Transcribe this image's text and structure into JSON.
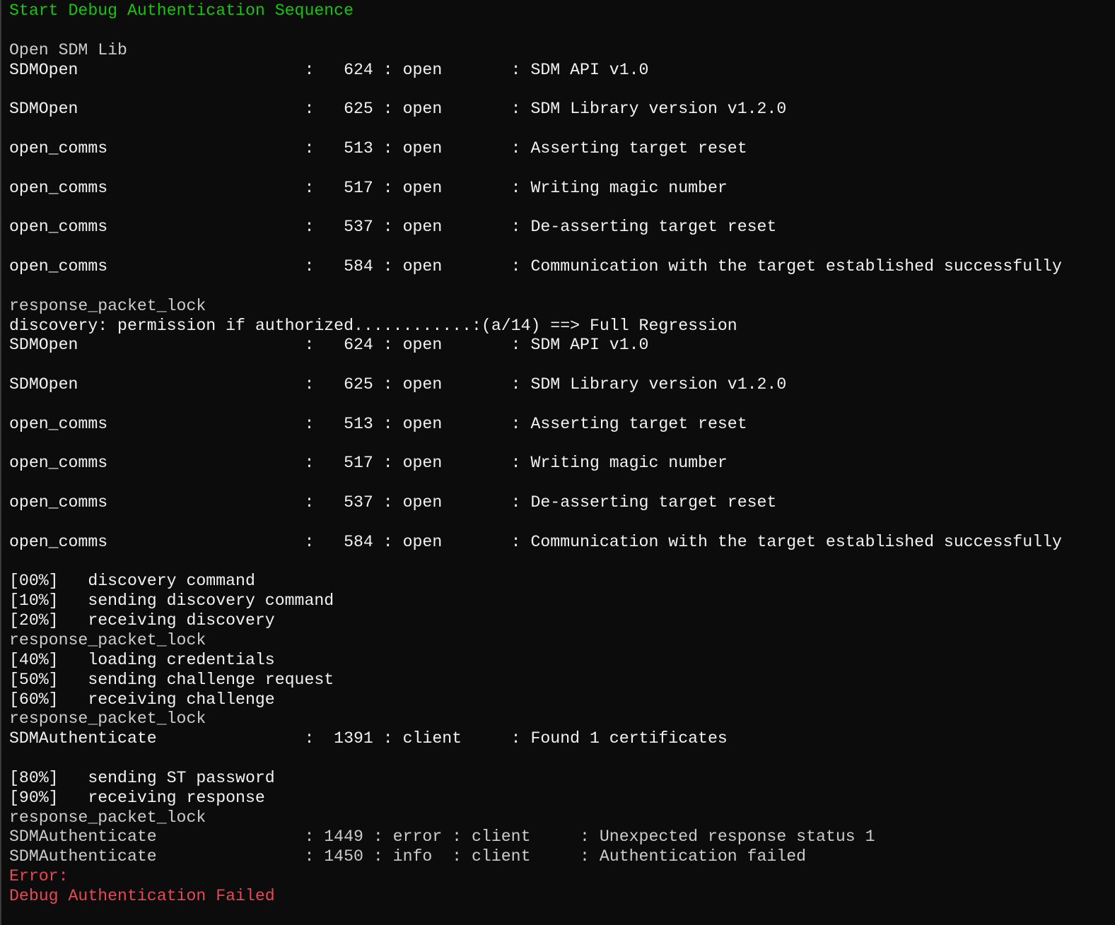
{
  "terminal": {
    "lines": [
      {
        "text": "Start Debug Authentication Sequence",
        "color": "green"
      },
      {
        "text": "",
        "color": "grey"
      },
      {
        "text": "Open SDM Lib",
        "color": "grey"
      },
      {
        "text": "SDMOpen                       :   624 : open       : SDM API v1.0",
        "color": "white"
      },
      {
        "text": "",
        "color": "grey"
      },
      {
        "text": "SDMOpen                       :   625 : open       : SDM Library version v1.2.0",
        "color": "white"
      },
      {
        "text": "",
        "color": "grey"
      },
      {
        "text": "open_comms                    :   513 : open       : Asserting target reset",
        "color": "white"
      },
      {
        "text": "",
        "color": "grey"
      },
      {
        "text": "open_comms                    :   517 : open       : Writing magic number",
        "color": "white"
      },
      {
        "text": "",
        "color": "grey"
      },
      {
        "text": "open_comms                    :   537 : open       : De-asserting target reset",
        "color": "white"
      },
      {
        "text": "",
        "color": "grey"
      },
      {
        "text": "open_comms                    :   584 : open       : Communication with the target established successfully",
        "color": "white"
      },
      {
        "text": "",
        "color": "grey"
      },
      {
        "text": "response_packet_lock",
        "color": "grey"
      },
      {
        "text": "discovery: permission if authorized............:(a/14) ==> Full Regression",
        "color": "white"
      },
      {
        "text": "SDMOpen                       :   624 : open       : SDM API v1.0",
        "color": "white"
      },
      {
        "text": "",
        "color": "grey"
      },
      {
        "text": "SDMOpen                       :   625 : open       : SDM Library version v1.2.0",
        "color": "white"
      },
      {
        "text": "",
        "color": "grey"
      },
      {
        "text": "open_comms                    :   513 : open       : Asserting target reset",
        "color": "white"
      },
      {
        "text": "",
        "color": "grey"
      },
      {
        "text": "open_comms                    :   517 : open       : Writing magic number",
        "color": "white"
      },
      {
        "text": "",
        "color": "grey"
      },
      {
        "text": "open_comms                    :   537 : open       : De-asserting target reset",
        "color": "white"
      },
      {
        "text": "",
        "color": "grey"
      },
      {
        "text": "open_comms                    :   584 : open       : Communication with the target established successfully",
        "color": "white"
      },
      {
        "text": "",
        "color": "grey"
      },
      {
        "text": "[00%]   discovery command",
        "color": "white"
      },
      {
        "text": "[10%]   sending discovery command",
        "color": "white"
      },
      {
        "text": "[20%]   receiving discovery",
        "color": "white"
      },
      {
        "text": "response_packet_lock",
        "color": "grey"
      },
      {
        "text": "[40%]   loading credentials",
        "color": "white"
      },
      {
        "text": "[50%]   sending challenge request",
        "color": "white"
      },
      {
        "text": "[60%]   receiving challenge",
        "color": "white"
      },
      {
        "text": "response_packet_lock",
        "color": "grey"
      },
      {
        "text": "SDMAuthenticate               :  1391 : client     : Found 1 certificates",
        "color": "white"
      },
      {
        "text": "",
        "color": "grey"
      },
      {
        "text": "[80%]   sending ST password",
        "color": "white"
      },
      {
        "text": "[90%]   receiving response",
        "color": "white"
      },
      {
        "text": "response_packet_lock",
        "color": "grey"
      },
      {
        "text": "SDMAuthenticate               : 1449 : error : client     : Unexpected response status 1",
        "color": "grey"
      },
      {
        "text": "SDMAuthenticate               : 1450 : info  : client     : Authentication failed",
        "color": "grey"
      },
      {
        "text": "Error:",
        "color": "red"
      },
      {
        "text": "Debug Authentication Failed",
        "color": "red"
      }
    ]
  }
}
